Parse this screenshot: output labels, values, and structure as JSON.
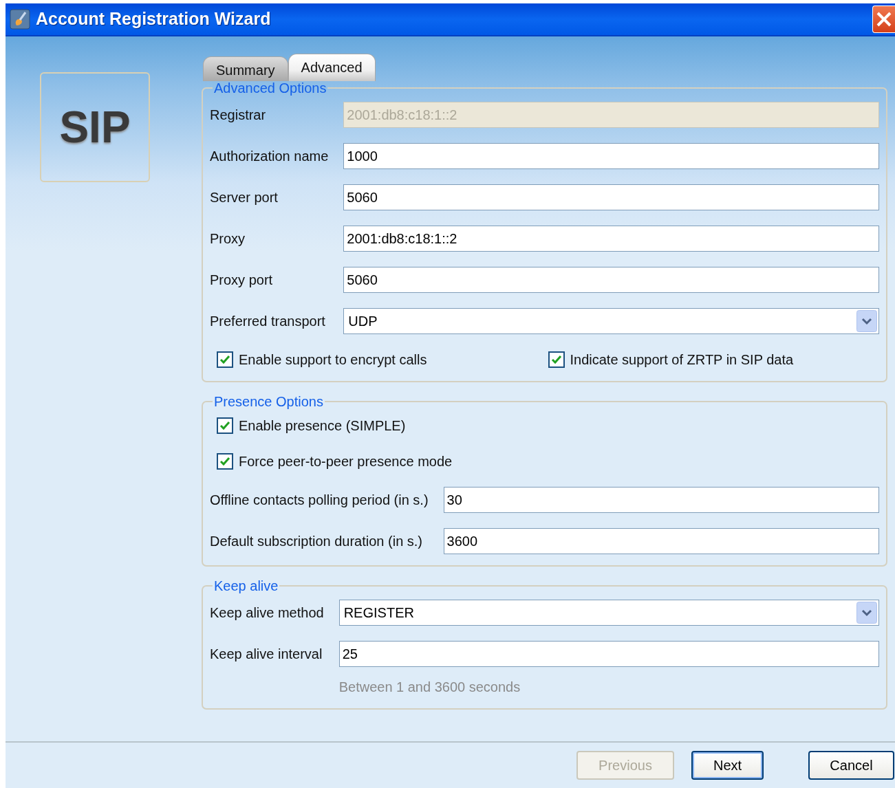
{
  "window": {
    "title": "Account Registration Wizard"
  },
  "logo": {
    "text": "SIP"
  },
  "tabs": [
    {
      "label": "Summary",
      "selected": false
    },
    {
      "label": "Advanced",
      "selected": true
    }
  ],
  "sections": [
    {
      "title": "Advanced Options",
      "items": [
        {
          "kind": "text",
          "label": "Registrar",
          "value": "2001:db8:c18:1::2",
          "disabled": true
        },
        {
          "kind": "text",
          "label": "Authorization name",
          "value": "1000",
          "disabled": false
        },
        {
          "kind": "text",
          "label": "Server port",
          "value": "5060",
          "disabled": false
        },
        {
          "kind": "text",
          "label": "Proxy",
          "value": "2001:db8:c18:1::2",
          "disabled": false
        },
        {
          "kind": "text",
          "label": "Proxy port",
          "value": "5060",
          "disabled": false
        },
        {
          "kind": "select",
          "label": "Preferred transport",
          "value": "UDP"
        },
        {
          "kind": "checks",
          "checkboxes": [
            {
              "label": "Enable support to encrypt calls",
              "checked": true
            },
            {
              "label": "Indicate support of ZRTP in SIP data",
              "checked": true
            }
          ]
        }
      ]
    },
    {
      "title": "Presence Options",
      "items": [
        {
          "kind": "checks",
          "checkboxes": [
            {
              "label": "Enable presence (SIMPLE)",
              "checked": true
            }
          ]
        },
        {
          "kind": "checks",
          "checkboxes": [
            {
              "label": "Force peer-to-peer presence mode",
              "checked": true
            }
          ]
        },
        {
          "kind": "text",
          "label": "Offline contacts polling period (in s.)",
          "value": "30",
          "disabled": false
        },
        {
          "kind": "text",
          "label": "Default subscription duration (in s.)",
          "value": "3600",
          "disabled": false
        }
      ]
    },
    {
      "title": "Keep alive",
      "items": [
        {
          "kind": "select",
          "label": "Keep alive method",
          "value": "REGISTER"
        },
        {
          "kind": "text",
          "label": "Keep alive interval",
          "value": "25",
          "disabled": false
        },
        {
          "kind": "hint",
          "text": "Between 1 and 3600 seconds"
        }
      ]
    }
  ],
  "buttons": [
    {
      "label": "Previous",
      "disabled": true,
      "focused": false
    },
    {
      "label": "Next",
      "disabled": false,
      "focused": true
    },
    {
      "label": "Cancel",
      "disabled": false,
      "focused": false
    }
  ]
}
